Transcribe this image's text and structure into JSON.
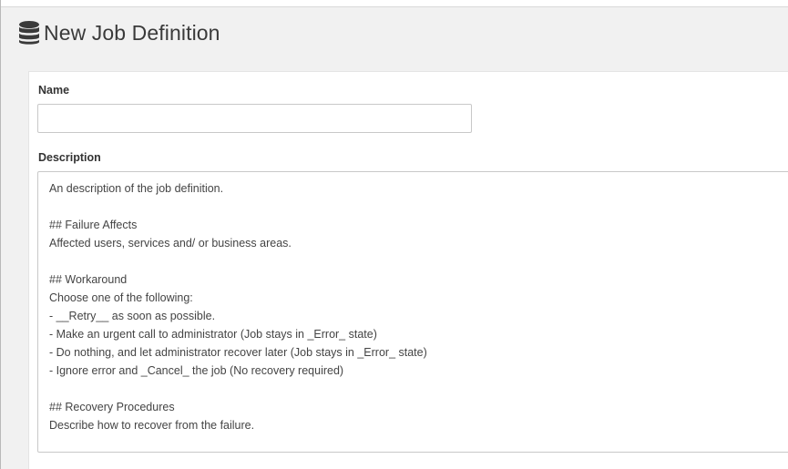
{
  "header": {
    "title": "New Job Definition",
    "icon": "database-icon"
  },
  "form": {
    "name_label": "Name",
    "name_value": "",
    "description_label": "Description",
    "description_lines": [
      "An description of the job definition.",
      "",
      "## Failure Affects",
      "Affected users, services and/ or business areas.",
      "",
      "## Workaround",
      "Choose one of the following:",
      "- __Retry__ as soon as possible.",
      "- Make an urgent call to administrator (Job stays in _Error_ state)",
      "- Do nothing, and let administrator recover later (Job stays in _Error_ state)",
      "- Ignore error and _Cancel_ the job (No recovery required)",
      "",
      "## Recovery Procedures",
      "Describe how to recover from the failure."
    ]
  },
  "colors": {
    "background": "#f1f1f1",
    "panel": "#ffffff",
    "border": "#c8c8c8",
    "text": "#333333"
  }
}
